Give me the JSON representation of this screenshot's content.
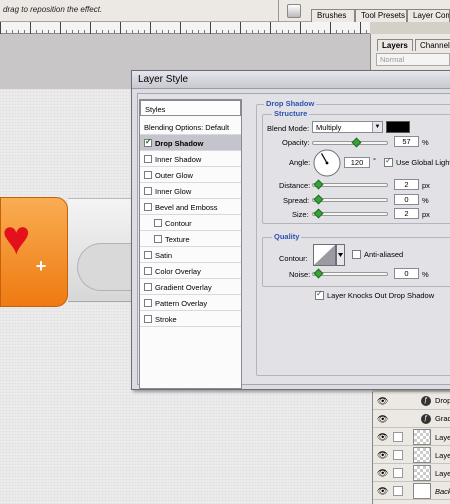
{
  "topbar": {
    "hint": "drag to reposition the effect.",
    "tabs": [
      "Brushes",
      "Tool Presets",
      "Layer Comp"
    ]
  },
  "panels": {
    "tabs": [
      "Layers",
      "Channels"
    ],
    "blend_mode": "Normal",
    "rows": [
      {
        "type": "effect",
        "label": "Drop"
      },
      {
        "type": "effect",
        "label": "Gradi"
      },
      {
        "type": "layer",
        "label": "Layer"
      },
      {
        "type": "layer",
        "label": "Layer"
      },
      {
        "type": "layer",
        "label": "Layer"
      },
      {
        "type": "layer",
        "label": "Backg"
      }
    ]
  },
  "dialog": {
    "title": "Layer Style",
    "styles_header": "Styles",
    "blending_options": "Blending Options: Default",
    "style_items": [
      {
        "label": "Drop Shadow",
        "checked": true,
        "selected": true,
        "indent": false
      },
      {
        "label": "Inner Shadow",
        "checked": false,
        "selected": false,
        "indent": false
      },
      {
        "label": "Outer Glow",
        "checked": false,
        "selected": false,
        "indent": false
      },
      {
        "label": "Inner Glow",
        "checked": false,
        "selected": false,
        "indent": false
      },
      {
        "label": "Bevel and Emboss",
        "checked": false,
        "selected": false,
        "indent": false
      },
      {
        "label": "Contour",
        "checked": false,
        "selected": false,
        "indent": true
      },
      {
        "label": "Texture",
        "checked": false,
        "selected": false,
        "indent": true
      },
      {
        "label": "Satin",
        "checked": false,
        "selected": false,
        "indent": false
      },
      {
        "label": "Color Overlay",
        "checked": false,
        "selected": false,
        "indent": false
      },
      {
        "label": "Gradient Overlay",
        "checked": false,
        "selected": false,
        "indent": false
      },
      {
        "label": "Pattern Overlay",
        "checked": false,
        "selected": false,
        "indent": false
      },
      {
        "label": "Stroke",
        "checked": false,
        "selected": false,
        "indent": false
      }
    ],
    "drop_shadow": {
      "section_title": "Drop Shadow",
      "structure_title": "Structure",
      "blend_mode_label": "Blend Mode:",
      "blend_mode_value": "Multiply",
      "shadow_color": "#000000",
      "opacity_label": "Opacity:",
      "opacity_value": "57",
      "opacity_unit": "%",
      "opacity_fraction": 0.57,
      "angle_label": "Angle:",
      "angle_value": "120",
      "angle_unit": "°",
      "use_global_light_label": "Use Global Light",
      "use_global_light": true,
      "distance_label": "Distance:",
      "distance_value": "2",
      "spread_label": "Spread:",
      "spread_value": "0",
      "size_label": "Size:",
      "size_value": "2",
      "px_unit": "px",
      "quality_title": "Quality",
      "contour_label": "Contour:",
      "anti_aliased_label": "Anti-aliased",
      "anti_aliased": false,
      "noise_label": "Noise:",
      "noise_value": "0",
      "noise_unit": "%",
      "knockout_label": "Layer Knocks Out Drop Shadow",
      "knockout": true
    }
  },
  "colors": {
    "accent_blue": "#2d52b0",
    "orange_tile": "#f49432",
    "heart": "#e4101c"
  }
}
